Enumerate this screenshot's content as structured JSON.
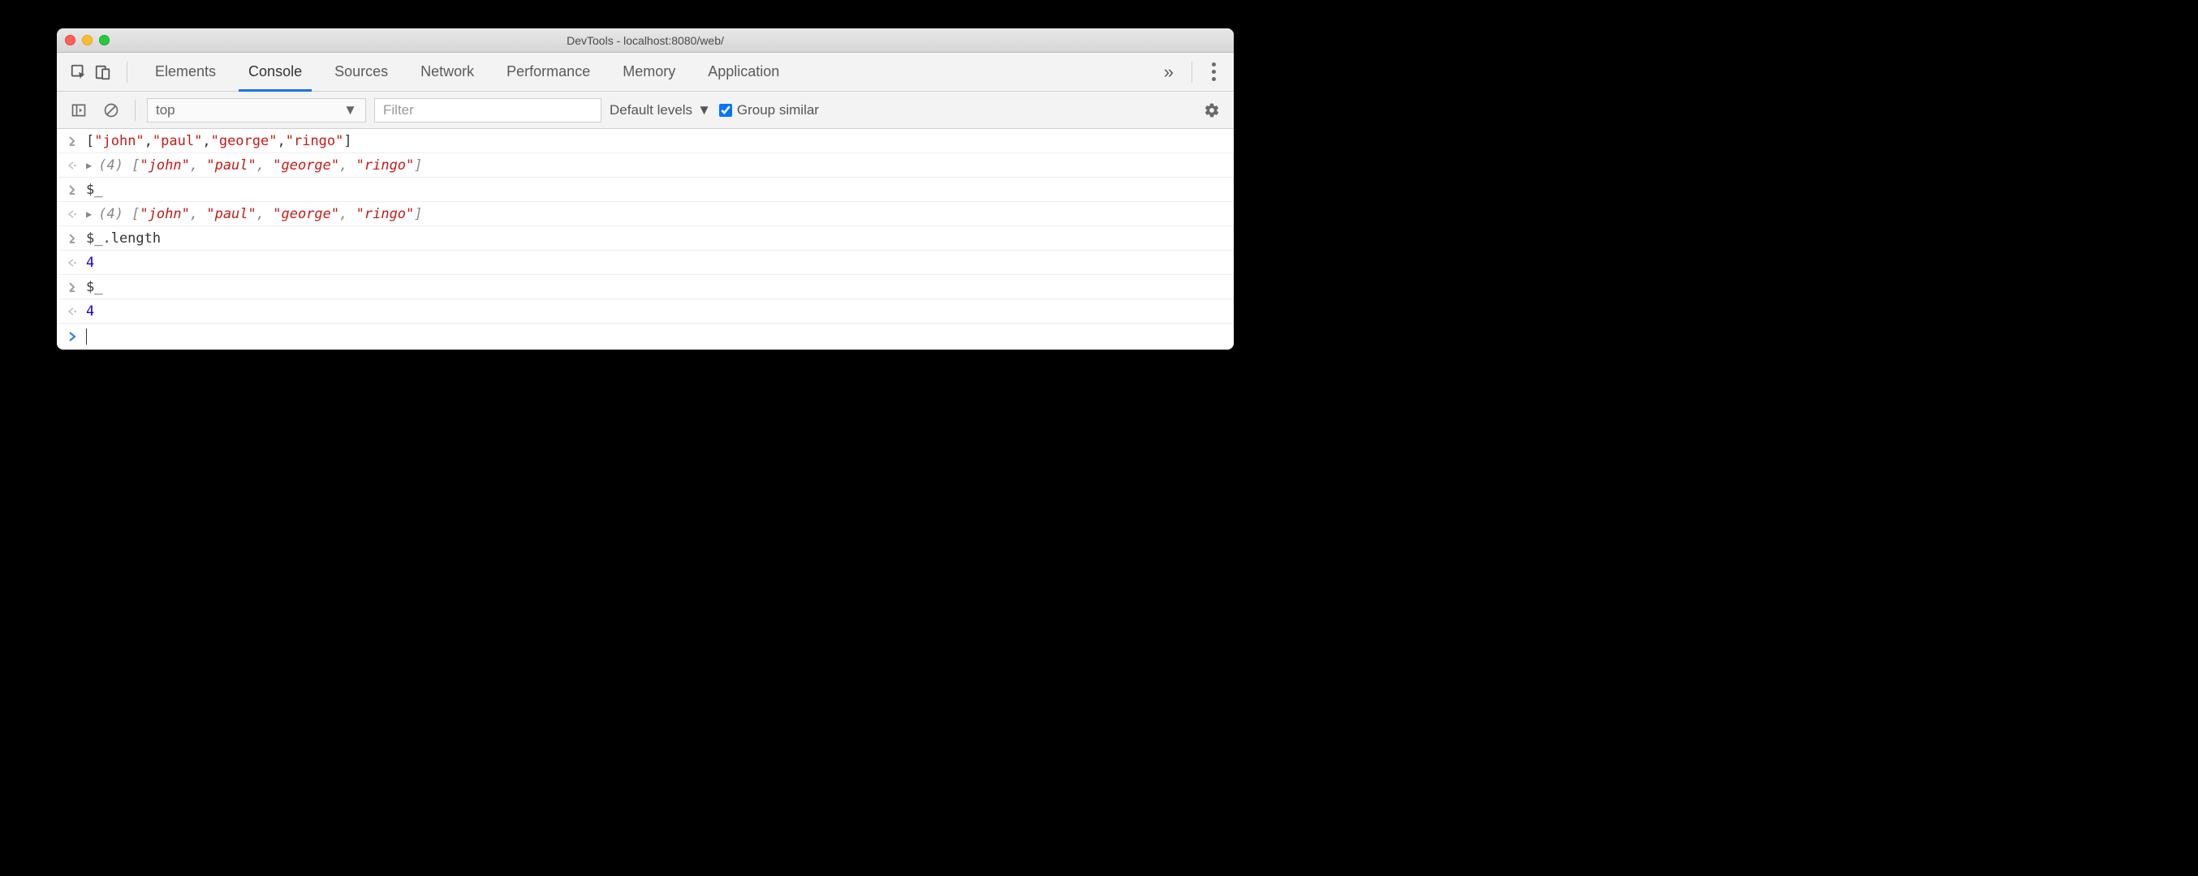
{
  "window": {
    "title": "DevTools - localhost:8080/web/"
  },
  "tabs": {
    "items": [
      "Elements",
      "Console",
      "Sources",
      "Network",
      "Performance",
      "Memory",
      "Application"
    ],
    "active_index": 1
  },
  "toolbar": {
    "context": "top",
    "filter_placeholder": "Filter",
    "levels_label": "Default levels",
    "group_similar_label": "Group similar",
    "group_similar_checked": true
  },
  "console": {
    "rows": [
      {
        "type": "input",
        "content": "[\"john\",\"paul\",\"george\",\"ringo\"]",
        "tokens": [
          {
            "t": "punct",
            "v": "["
          },
          {
            "t": "str",
            "v": "\"john\""
          },
          {
            "t": "punct",
            "v": ","
          },
          {
            "t": "str",
            "v": "\"paul\""
          },
          {
            "t": "punct",
            "v": ","
          },
          {
            "t": "str",
            "v": "\"george\""
          },
          {
            "t": "punct",
            "v": ","
          },
          {
            "t": "str",
            "v": "\"ringo\""
          },
          {
            "t": "punct",
            "v": "]"
          }
        ]
      },
      {
        "type": "output",
        "expandable": true,
        "prefix": "(4) ",
        "tokens": [
          {
            "t": "punct",
            "v": "["
          },
          {
            "t": "str",
            "v": "\"john\""
          },
          {
            "t": "punct",
            "v": ", "
          },
          {
            "t": "str",
            "v": "\"paul\""
          },
          {
            "t": "punct",
            "v": ", "
          },
          {
            "t": "str",
            "v": "\"george\""
          },
          {
            "t": "punct",
            "v": ", "
          },
          {
            "t": "str",
            "v": "\"ringo\""
          },
          {
            "t": "punct",
            "v": "]"
          }
        ]
      },
      {
        "type": "input",
        "content": "$_",
        "tokens": [
          {
            "t": "punct",
            "v": "$_"
          }
        ]
      },
      {
        "type": "output",
        "expandable": true,
        "prefix": "(4) ",
        "tokens": [
          {
            "t": "punct",
            "v": "["
          },
          {
            "t": "str",
            "v": "\"john\""
          },
          {
            "t": "punct",
            "v": ", "
          },
          {
            "t": "str",
            "v": "\"paul\""
          },
          {
            "t": "punct",
            "v": ", "
          },
          {
            "t": "str",
            "v": "\"george\""
          },
          {
            "t": "punct",
            "v": ", "
          },
          {
            "t": "str",
            "v": "\"ringo\""
          },
          {
            "t": "punct",
            "v": "]"
          }
        ]
      },
      {
        "type": "input",
        "content": "$_.length",
        "tokens": [
          {
            "t": "punct",
            "v": "$_.length"
          }
        ]
      },
      {
        "type": "output",
        "expandable": false,
        "tokens": [
          {
            "t": "num",
            "v": "4"
          }
        ]
      },
      {
        "type": "input",
        "content": "$_",
        "tokens": [
          {
            "t": "punct",
            "v": "$_"
          }
        ]
      },
      {
        "type": "output",
        "expandable": false,
        "tokens": [
          {
            "t": "num",
            "v": "4"
          }
        ]
      }
    ]
  }
}
